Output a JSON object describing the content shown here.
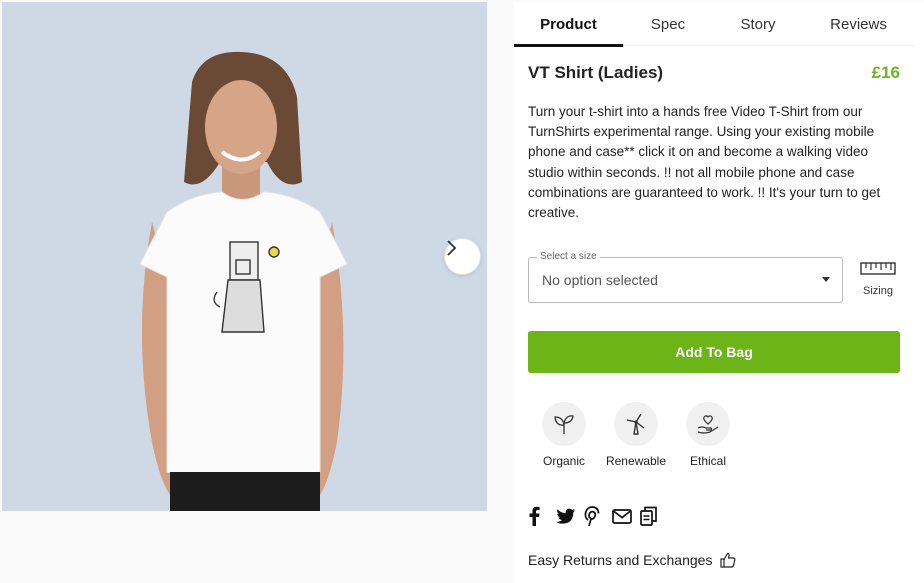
{
  "tabs": [
    {
      "label": "Product",
      "active": true
    },
    {
      "label": "Spec"
    },
    {
      "label": "Story"
    },
    {
      "label": "Reviews"
    }
  ],
  "product": {
    "title": "VT Shirt (Ladies)",
    "price": "£16",
    "description": "Turn your t-shirt into a hands free Video T-Shirt from our TurnShirts experimental range. Using your existing mobile phone and case** click it on and become a walking video studio within seconds. !! not all mobile phone and case combinations are guaranteed to work. !! It's your turn to get creative."
  },
  "size_select": {
    "legend": "Select a size",
    "value": "No option selected"
  },
  "sizing": {
    "label": "Sizing",
    "icon": "ruler-icon"
  },
  "add_to_bag": "Add To Bag",
  "badges": [
    {
      "label": "Organic",
      "icon": "sprout-icon"
    },
    {
      "label": "Renewable",
      "icon": "wind-turbine-icon"
    },
    {
      "label": "Ethical",
      "icon": "heart-hand-icon"
    }
  ],
  "share_icons": [
    "facebook-icon",
    "twitter-icon",
    "pinterest-icon",
    "email-icon",
    "copy-link-icon"
  ],
  "returns": {
    "label": "Easy Returns and Exchanges",
    "icon": "thumbs-up-icon"
  },
  "gallery": {
    "next_icon": "chevron-right-icon"
  },
  "colors": {
    "accent_green": "#6cb417",
    "price_green": "#6cb42c",
    "photo_background": "#cfd9e5"
  }
}
